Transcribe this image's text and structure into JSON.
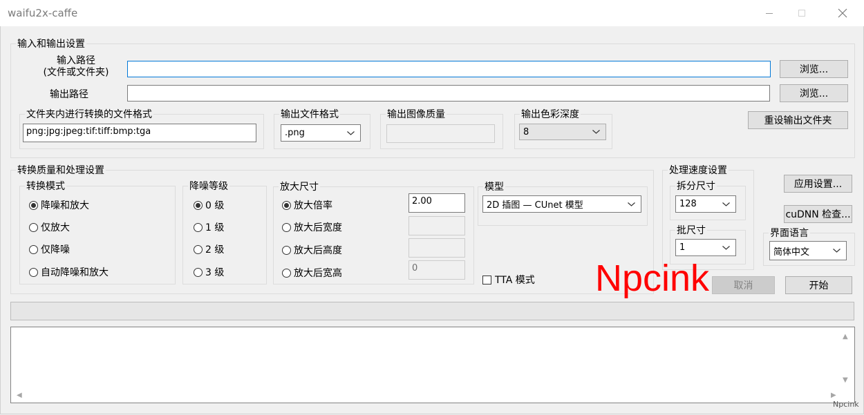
{
  "window": {
    "title": "waifu2x-caffe"
  },
  "io": {
    "group_title": "输入和输出设置",
    "input_label_line1": "输入路径",
    "input_label_line2": "(文件或文件夹)",
    "input_value": "",
    "output_label": "输出路径",
    "output_value": "",
    "browse_label": "浏览...",
    "folder_ext_title": "文件夹内进行转换的文件格式",
    "folder_ext_value": "png:jpg:jpeg:tif:tiff:bmp:tga",
    "out_format_title": "输出文件格式",
    "out_format_value": ".png",
    "out_quality_title": "输出图像质量",
    "out_quality_value": "",
    "out_depth_title": "输出色彩深度",
    "out_depth_value": "8",
    "reset_folder_label": "重设输出文件夹"
  },
  "quality": {
    "group_title": "转换质量和处理设置",
    "mode": {
      "title": "转换模式",
      "options": [
        "降噪和放大",
        "仅放大",
        "仅降噪",
        "自动降噪和放大"
      ],
      "selected": 0
    },
    "noise": {
      "title": "降噪等级",
      "options": [
        "0 级",
        "1 级",
        "2 级",
        "3 级"
      ],
      "selected": 0
    },
    "scale": {
      "title": "放大尺寸",
      "options": [
        "放大倍率",
        "放大后宽度",
        "放大后高度",
        "放大后宽高"
      ],
      "selected": 0,
      "ratio_value": "2.00",
      "width_value": "",
      "height_value": "",
      "wh_value": "0"
    },
    "model": {
      "title": "模型",
      "value": "2D 插图 — CUnet 模型"
    },
    "tta_label": "TTA 模式"
  },
  "speed": {
    "group_title": "处理速度设置",
    "split_title": "拆分尺寸",
    "split_value": "128",
    "batch_title": "批尺寸",
    "batch_value": "1"
  },
  "app_settings_label": "应用设置...",
  "cudnn_label": "cuDNN 检查...",
  "language": {
    "title": "界面语言",
    "value": "简体中文"
  },
  "cancel_label": "取消",
  "start_label": "开始",
  "watermark": "Npcink",
  "corner_mark": "Npcink",
  "icons": [
    "minimize-icon",
    "maximize-icon",
    "close-icon",
    "chevron-down-icon",
    "scroll-up-icon",
    "scroll-down-icon",
    "scroll-left-icon",
    "scroll-right-icon"
  ]
}
